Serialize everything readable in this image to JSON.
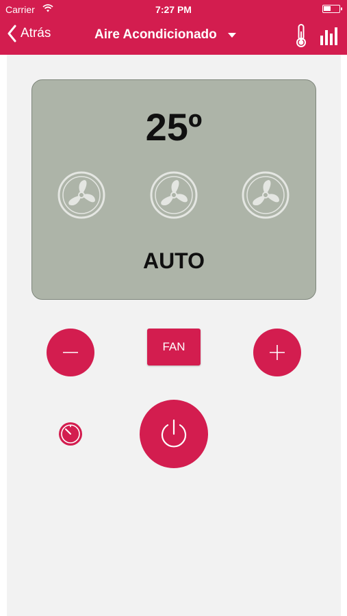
{
  "status_bar": {
    "carrier": "Carrier",
    "time": "7:27 PM"
  },
  "nav": {
    "back_label": "Atrás",
    "title": "Aire Acondicionado"
  },
  "display": {
    "temperature": "25º",
    "mode": "AUTO"
  },
  "controls": {
    "fan_label": "FAN"
  },
  "colors": {
    "accent": "#d31d4f",
    "display_bg": "#adb4a8",
    "panel_bg": "#f2f2f2"
  },
  "icons": [
    "wifi-icon",
    "battery-icon",
    "back-chevron-icon",
    "caret-down-icon",
    "thermometer-icon",
    "bar-chart-icon",
    "fan-icon",
    "minus-icon",
    "plus-icon",
    "power-icon",
    "timer-icon"
  ]
}
